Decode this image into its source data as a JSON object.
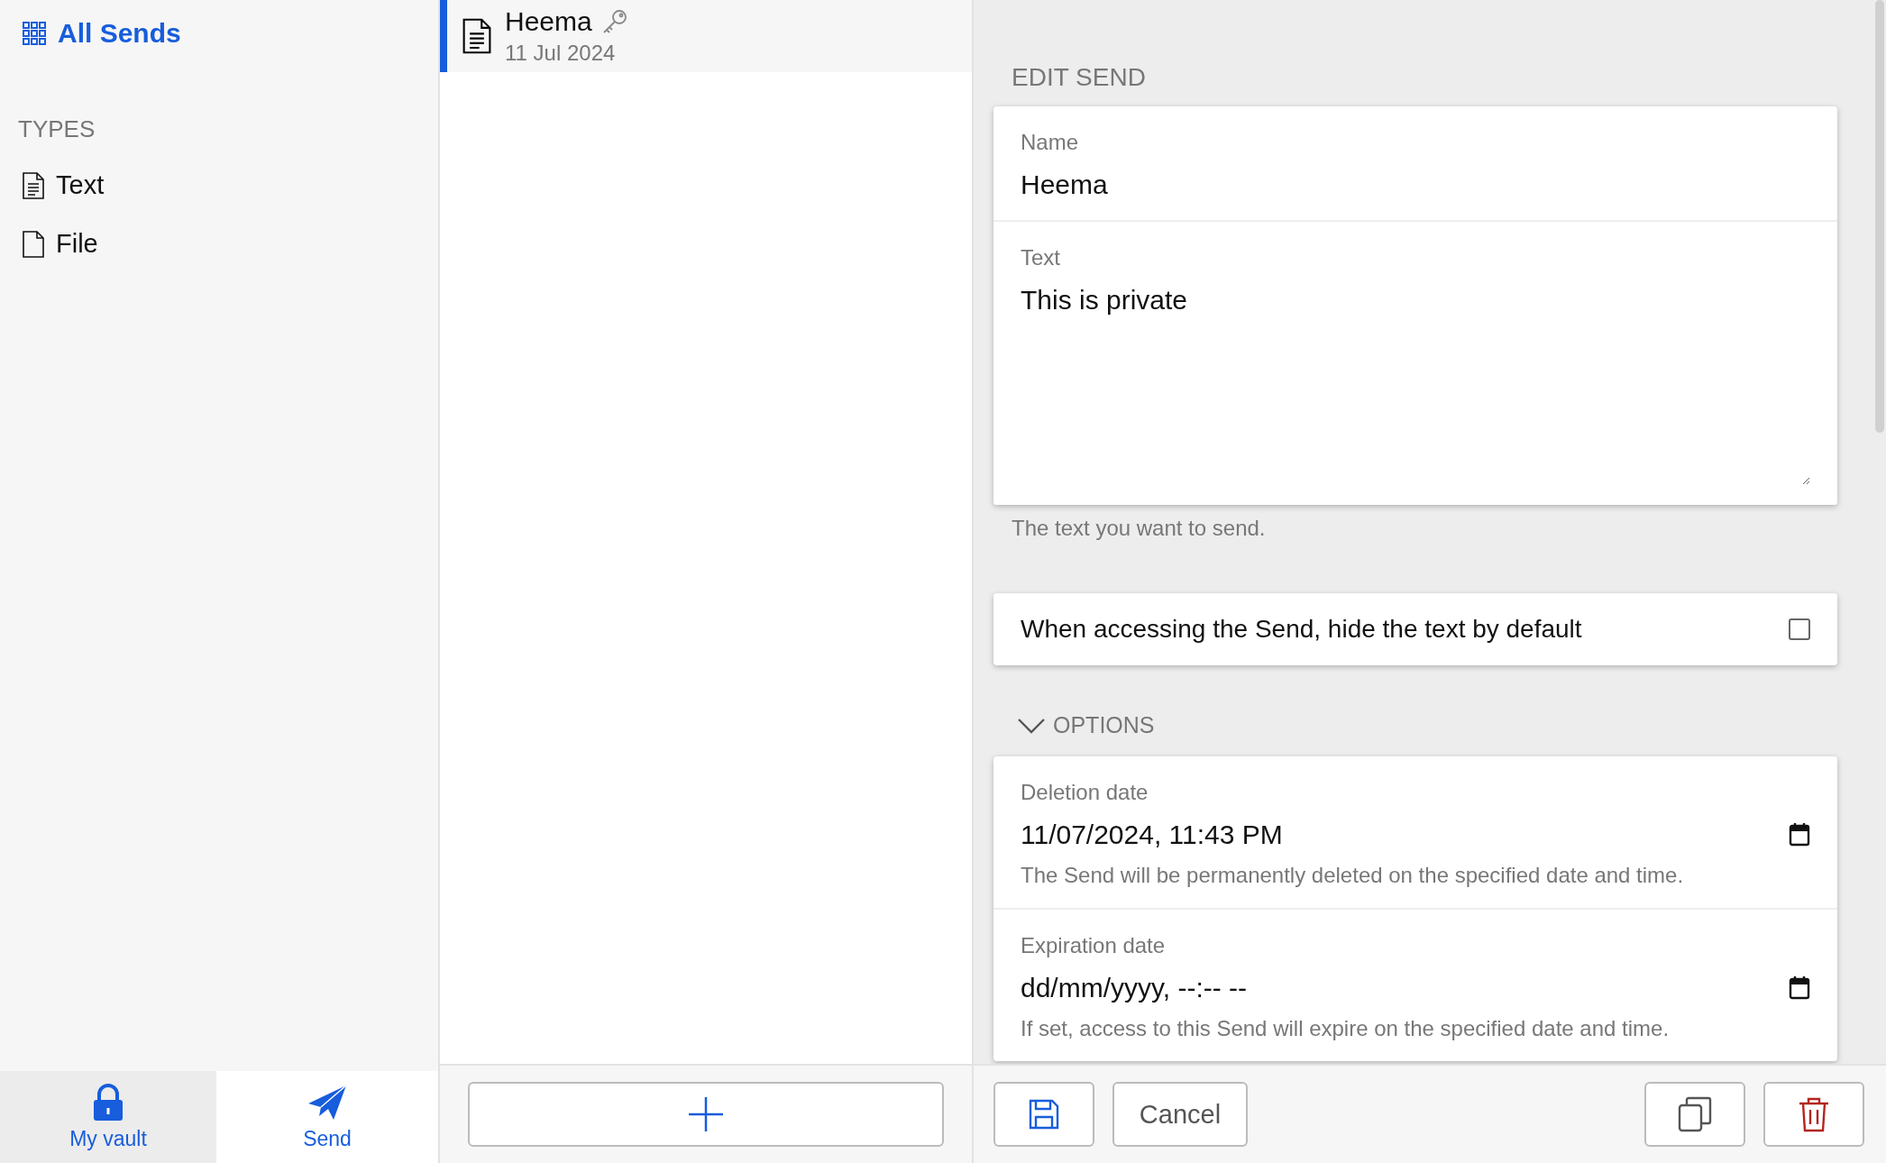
{
  "sidebar": {
    "all_sends": {
      "label": "All Sends",
      "selected": true
    },
    "types_heading": "TYPES",
    "types": [
      {
        "kind": "text",
        "label": "Text",
        "selected": false
      },
      {
        "kind": "file",
        "label": "File",
        "selected": false
      }
    ]
  },
  "bottom_nav": [
    {
      "kind": "vault",
      "label": "My vault",
      "selected": false
    },
    {
      "kind": "send",
      "label": "Send",
      "selected": true
    }
  ],
  "send_list": [
    {
      "kind": "text",
      "name": "Heema",
      "date": "11 Jul 2024",
      "selected": true,
      "password": true
    }
  ],
  "edit": {
    "title": "EDIT SEND",
    "name": {
      "label": "Name",
      "value": "Heema"
    },
    "text": {
      "label": "Text",
      "value": "This is private",
      "hint": "The text you want to send."
    },
    "hide_text": {
      "label": "When accessing the Send, hide the text by default",
      "checked": false
    },
    "options": {
      "label": "OPTIONS",
      "expanded": true
    },
    "deletion_date": {
      "label": "Deletion date",
      "value": "11/07/2024, 11:43 PM",
      "hint": "The Send will be permanently deleted on the specified date and time."
    },
    "expiration_date": {
      "label": "Expiration date",
      "placeholder": "dd/mm/yyyy, --:-- --",
      "hint": "If set, access to this Send will expire on the specified date and time."
    }
  },
  "actions": {
    "cancel": "Cancel"
  }
}
